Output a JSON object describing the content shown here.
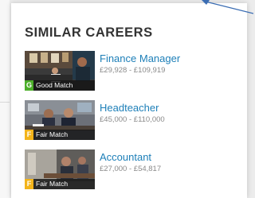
{
  "panel": {
    "title": "SIMILAR CAREERS"
  },
  "colors": {
    "link": "#1d7fb8",
    "good_match": "#4caf2a",
    "fair_match": "#f3b41a",
    "arrow": "#3b6db3"
  },
  "careers": [
    {
      "name": "Finance Manager",
      "salary": "£29,928 - £109,919",
      "match_code": "G",
      "match_label": "Good Match",
      "image_icon": "office-meeting-photo"
    },
    {
      "name": "Headteacher",
      "salary": "£45,000 - £110,000",
      "match_code": "F",
      "match_label": "Fair Match",
      "image_icon": "office-discussion-photo"
    },
    {
      "name": "Accountant",
      "salary": "£27,000 - £54,817",
      "match_code": "F",
      "match_label": "Fair Match",
      "image_icon": "office-desk-photo"
    }
  ]
}
